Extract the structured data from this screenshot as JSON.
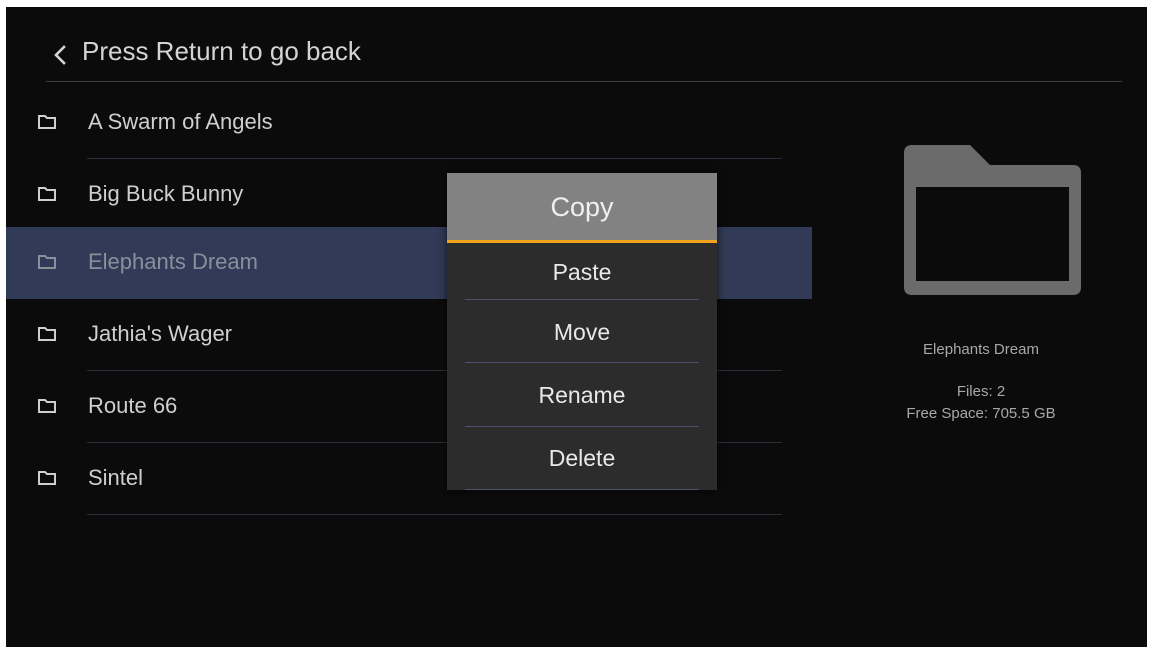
{
  "header": {
    "back_icon": "chevron-left-icon",
    "title": "Press Return to go back"
  },
  "files": [
    {
      "name": "A Swarm of Angels",
      "icon": "folder-icon",
      "selected": false
    },
    {
      "name": "Big Buck Bunny",
      "icon": "folder-icon",
      "selected": false
    },
    {
      "name": "Elephants Dream",
      "icon": "folder-icon",
      "selected": true
    },
    {
      "name": "Jathia's Wager",
      "icon": "folder-icon",
      "selected": false
    },
    {
      "name": "Route 66",
      "icon": "folder-icon",
      "selected": false
    },
    {
      "name": "Sintel",
      "icon": "folder-icon",
      "selected": false
    }
  ],
  "context_menu": {
    "items": [
      {
        "label": "Copy",
        "focused": true
      },
      {
        "label": "Paste",
        "focused": false
      },
      {
        "label": "Move",
        "focused": false
      },
      {
        "label": "Rename",
        "focused": false
      },
      {
        "label": "Delete",
        "focused": false
      }
    ]
  },
  "preview": {
    "icon": "folder-icon",
    "name": "Elephants Dream",
    "files": "Files: 2",
    "free_space": "Free Space: 705.5 GB"
  },
  "colors": {
    "background": "#0b0b0b",
    "selected_row": "#313a56",
    "menu_background": "#2c2c2c",
    "menu_focused": "#828282",
    "focus_accent": "#f0a41b",
    "preview_icon": "#6b6b6b"
  }
}
